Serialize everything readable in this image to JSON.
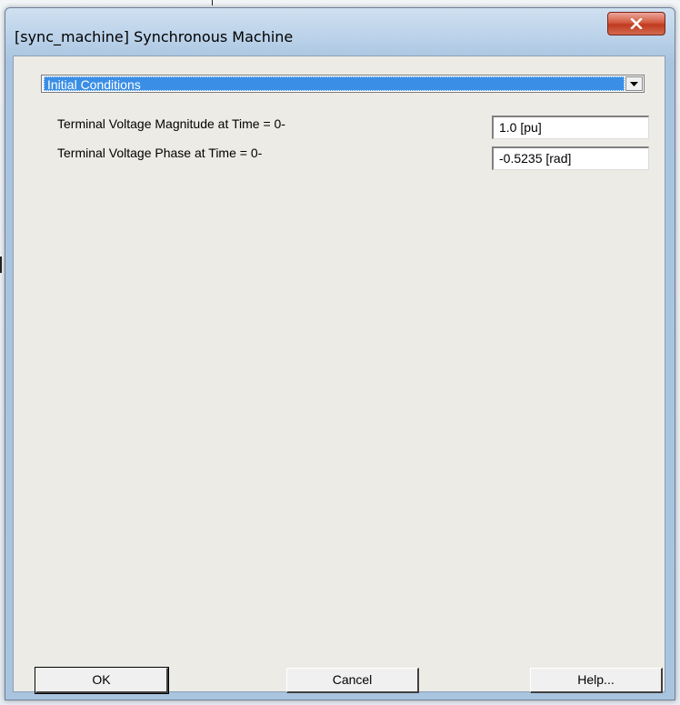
{
  "window": {
    "title": "[sync_machine] Synchronous Machine"
  },
  "category": {
    "selected": "Initial Conditions"
  },
  "parameters": [
    {
      "label": "Terminal Voltage Magnitude at Time = 0-",
      "value": "1.0 [pu]"
    },
    {
      "label": "Terminal Voltage Phase at Time = 0-",
      "value": "-0.5235 [rad]"
    }
  ],
  "buttons": {
    "ok": "OK",
    "cancel": "Cancel",
    "help": "Help..."
  },
  "colors": {
    "selection": "#3a8ee6",
    "close_button": "#c03a20",
    "client_bg": "#ecebe6"
  },
  "icons": {
    "close": "close-icon",
    "dropdown": "chevron-down-icon"
  }
}
